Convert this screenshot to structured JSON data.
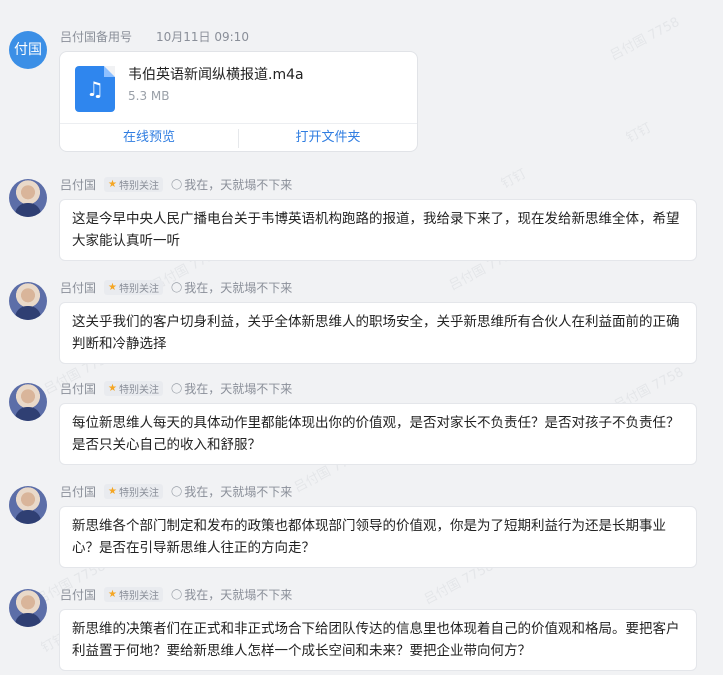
{
  "first_message": {
    "avatar_text": "付国",
    "sender": "吕付国备用号",
    "time": "10月11日 09:10",
    "file": {
      "icon": "music-note-icon",
      "name": "韦伯英语新闻纵横报道.m4a",
      "size": "5.3 MB",
      "preview_label": "在线预览",
      "open_folder_label": "打开文件夹"
    }
  },
  "messages": [
    {
      "sender": "吕付国",
      "tag": "特别关注",
      "signature": "我在，天就塌不下来",
      "text": "这是今早中央人民广播电台关于韦博英语机构跑路的报道，我给录下来了，现在发给新思维全体，希望大家能认真听一听"
    },
    {
      "sender": "吕付国",
      "tag": "特别关注",
      "signature": "我在，天就塌不下来",
      "text": "这关乎我们的客户切身利益，关乎全体新思维人的职场安全，关乎新思维所有合伙人在利益面前的正确判断和冷静选择"
    },
    {
      "sender": "吕付国",
      "tag": "特别关注",
      "signature": "我在，天就塌不下来",
      "text": "每位新思维人每天的具体动作里都能体现出你的价值观，是否对家长不负责任？是否对孩子不负责任？是否只关心自己的收入和舒服？"
    },
    {
      "sender": "吕付国",
      "tag": "特别关注",
      "signature": "我在，天就塌不下来",
      "text": "新思维各个部门制定和发布的政策也都体现部门领导的价值观，你是为了短期利益行为还是长期事业心？是否在引导新思维人往正的方向走？"
    },
    {
      "sender": "吕付国",
      "tag": "特别关注",
      "signature": "我在，天就塌不下来",
      "text": "新思维的决策者们在正式和非正式场合下给团队传达的信息里也体现着自己的价值观和格局。要把客户利益置于何地？要给新思维人怎样一个成长空间和未来？要把企业带向何方？"
    }
  ],
  "watermark": {
    "text_a": "吕付国 7758",
    "text_b": "钉钉"
  },
  "colors": {
    "accent": "#2f7de1",
    "avatar_bg": "#3b8fe6",
    "star": "#f5a623",
    "background": "#f1f2f4"
  }
}
